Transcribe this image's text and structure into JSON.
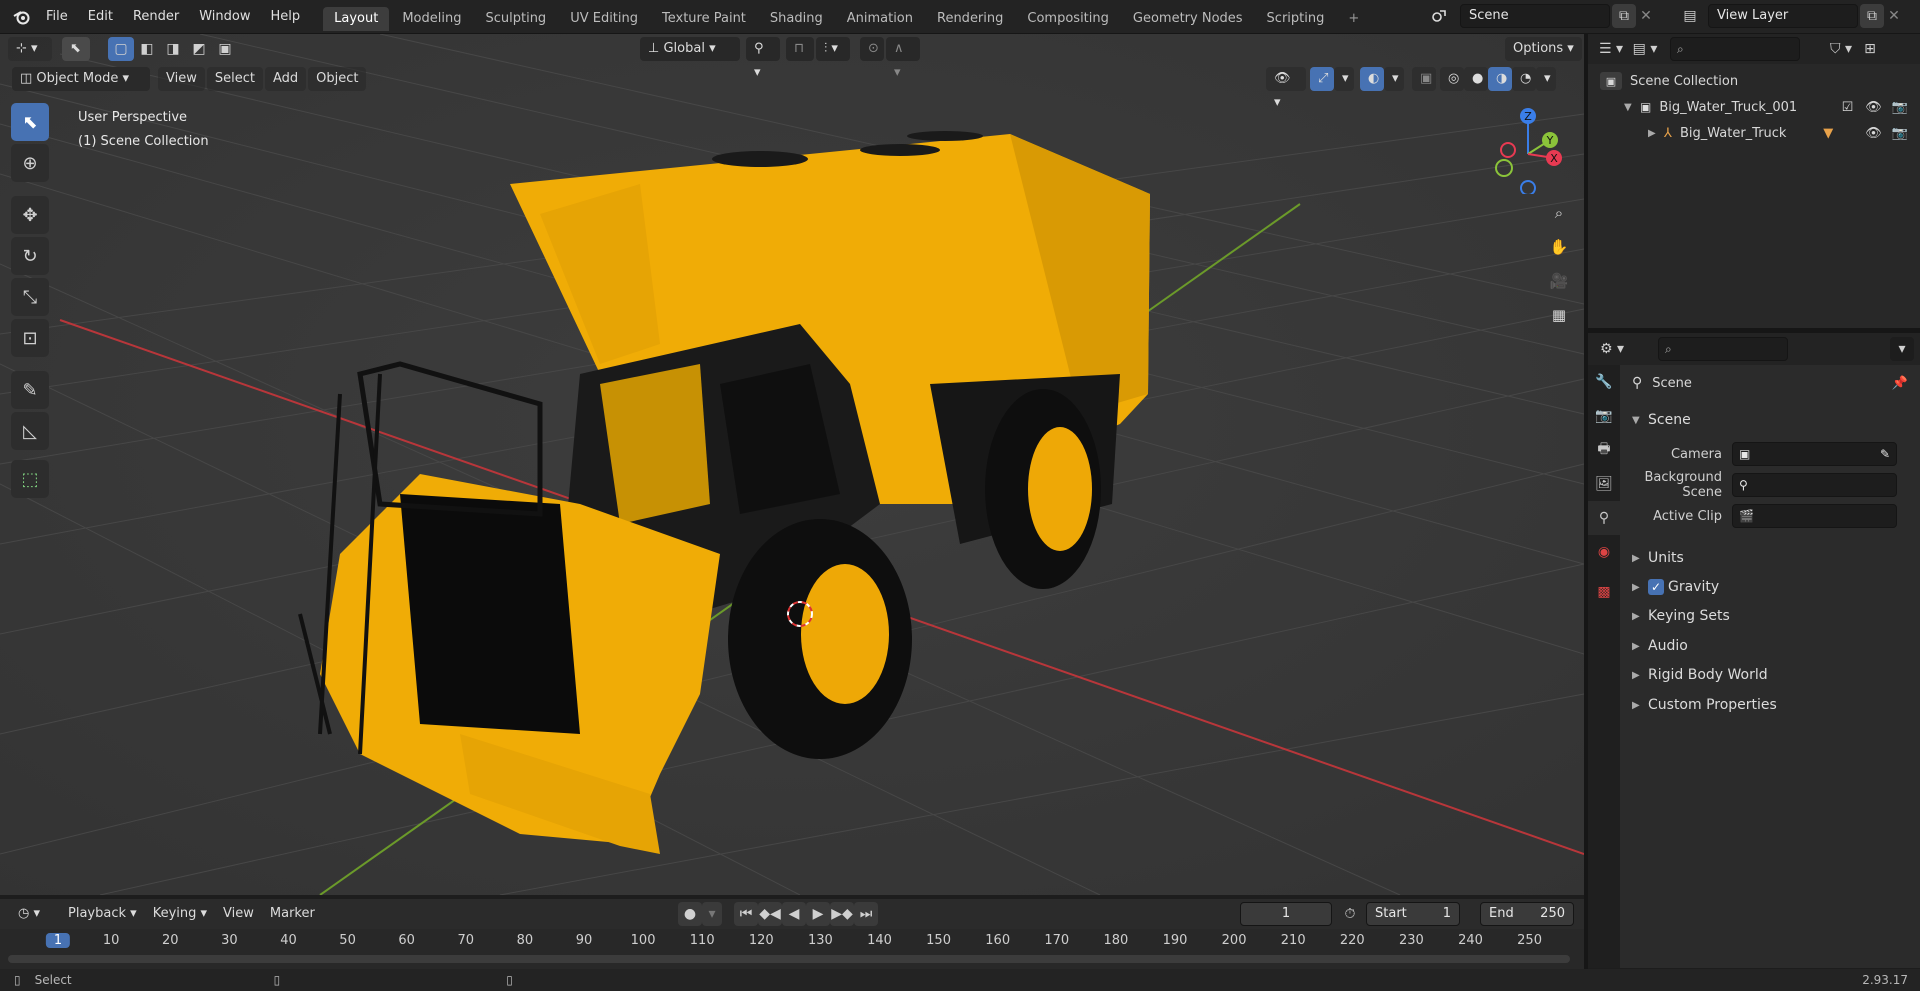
{
  "topbar": {
    "menus": [
      "File",
      "Edit",
      "Render",
      "Window",
      "Help"
    ],
    "workspaces": [
      "Layout",
      "Modeling",
      "Sculpting",
      "UV Editing",
      "Texture Paint",
      "Shading",
      "Animation",
      "Rendering",
      "Compositing",
      "Geometry Nodes",
      "Scripting"
    ],
    "active_workspace": "Layout",
    "add_workspace": "+",
    "scene_name": "Scene",
    "view_layer": "View Layer"
  },
  "viewport": {
    "mode": "Object Mode",
    "menus": [
      "View",
      "Select",
      "Add",
      "Object"
    ],
    "transform_orientation": "Global",
    "options_label": "Options",
    "info_line1": "User Perspective",
    "info_line2": "(1) Scene Collection",
    "gizmo_axes": {
      "z": "Z",
      "y": "Y",
      "x": "X"
    },
    "colors": {
      "x_axis": "#b8363a",
      "y_axis": "#6b9a2a",
      "truck_body": "#f0ac06",
      "truck_dark": "#0d0d0d",
      "grid": "#474747",
      "bg": "#3a3a3a"
    }
  },
  "outliner": {
    "search_placeholder": "",
    "root": "Scene Collection",
    "items": [
      {
        "label": "Big_Water_Truck_001",
        "level": 1
      },
      {
        "label": "Big_Water_Truck",
        "level": 2
      }
    ]
  },
  "properties": {
    "search_placeholder": "",
    "context": "Scene",
    "panel_title": "Scene",
    "fields": [
      {
        "label": "Camera",
        "value": ""
      },
      {
        "label": "Background Scene",
        "value": ""
      },
      {
        "label": "Active Clip",
        "value": ""
      }
    ],
    "subpanels": [
      "Units",
      "Gravity",
      "Keying Sets",
      "Audio",
      "Rigid Body World",
      "Custom Properties"
    ],
    "gravity_checked": true
  },
  "timeline": {
    "menus": [
      "Playback",
      "Keying",
      "View",
      "Marker"
    ],
    "current_frame": "1",
    "start_label": "Start",
    "start_value": "1",
    "end_label": "End",
    "end_value": "250",
    "ticks": [
      "1",
      "10",
      "20",
      "30",
      "40",
      "50",
      "60",
      "70",
      "80",
      "90",
      "100",
      "110",
      "120",
      "130",
      "140",
      "150",
      "160",
      "170",
      "180",
      "190",
      "200",
      "210",
      "220",
      "230",
      "240",
      "250"
    ]
  },
  "status": {
    "left": "Select",
    "version": "2.93.17"
  }
}
